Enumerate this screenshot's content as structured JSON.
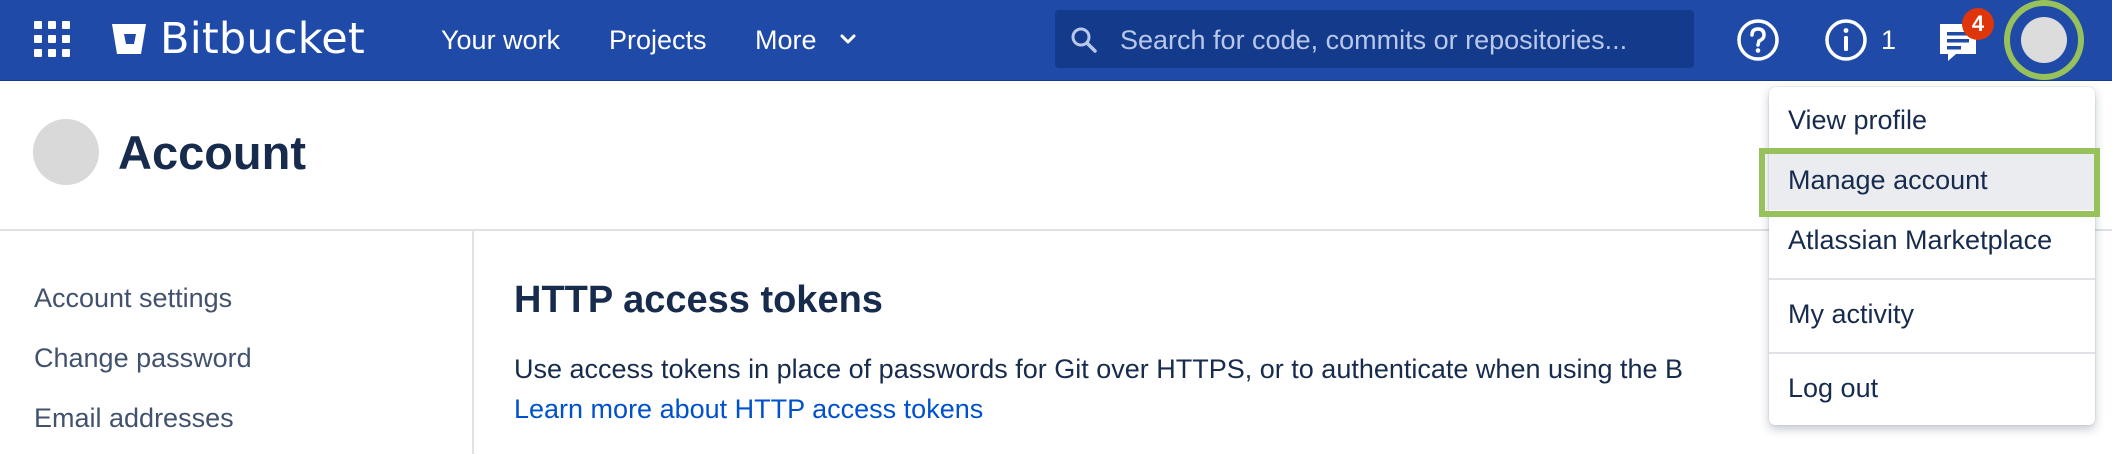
{
  "topbar": {
    "brand": "Bitbucket",
    "nav": {
      "your_work": "Your work",
      "projects": "Projects",
      "more": "More"
    },
    "search": {
      "placeholder": "Search for code, commits or repositories..."
    },
    "info_count": "1",
    "notifications_badge": "4",
    "icons": [
      "app-switcher-icon",
      "bitbucket-logo-icon",
      "chevron-down-icon",
      "search-icon",
      "help-icon",
      "info-icon",
      "notifications-icon"
    ],
    "colors": {
      "bar": "#1f4aa8",
      "badge": "#de350b",
      "highlight": "#97c15b"
    }
  },
  "page": {
    "title": "Account"
  },
  "sidebar": {
    "items": [
      {
        "label": "Account settings"
      },
      {
        "label": "Change password"
      },
      {
        "label": "Email addresses"
      }
    ]
  },
  "main": {
    "section_title": "HTTP access tokens",
    "description": "Use access tokens in place of passwords for Git over HTTPS, or to authenticate when using the B",
    "learn_more": "Learn more about HTTP access tokens"
  },
  "user_menu": {
    "items": [
      {
        "label": "View profile"
      },
      {
        "label": "Manage account"
      },
      {
        "label": "Atlassian Marketplace"
      },
      {
        "label": "My activity"
      },
      {
        "label": "Log out"
      }
    ],
    "highlighted": "Manage account"
  }
}
